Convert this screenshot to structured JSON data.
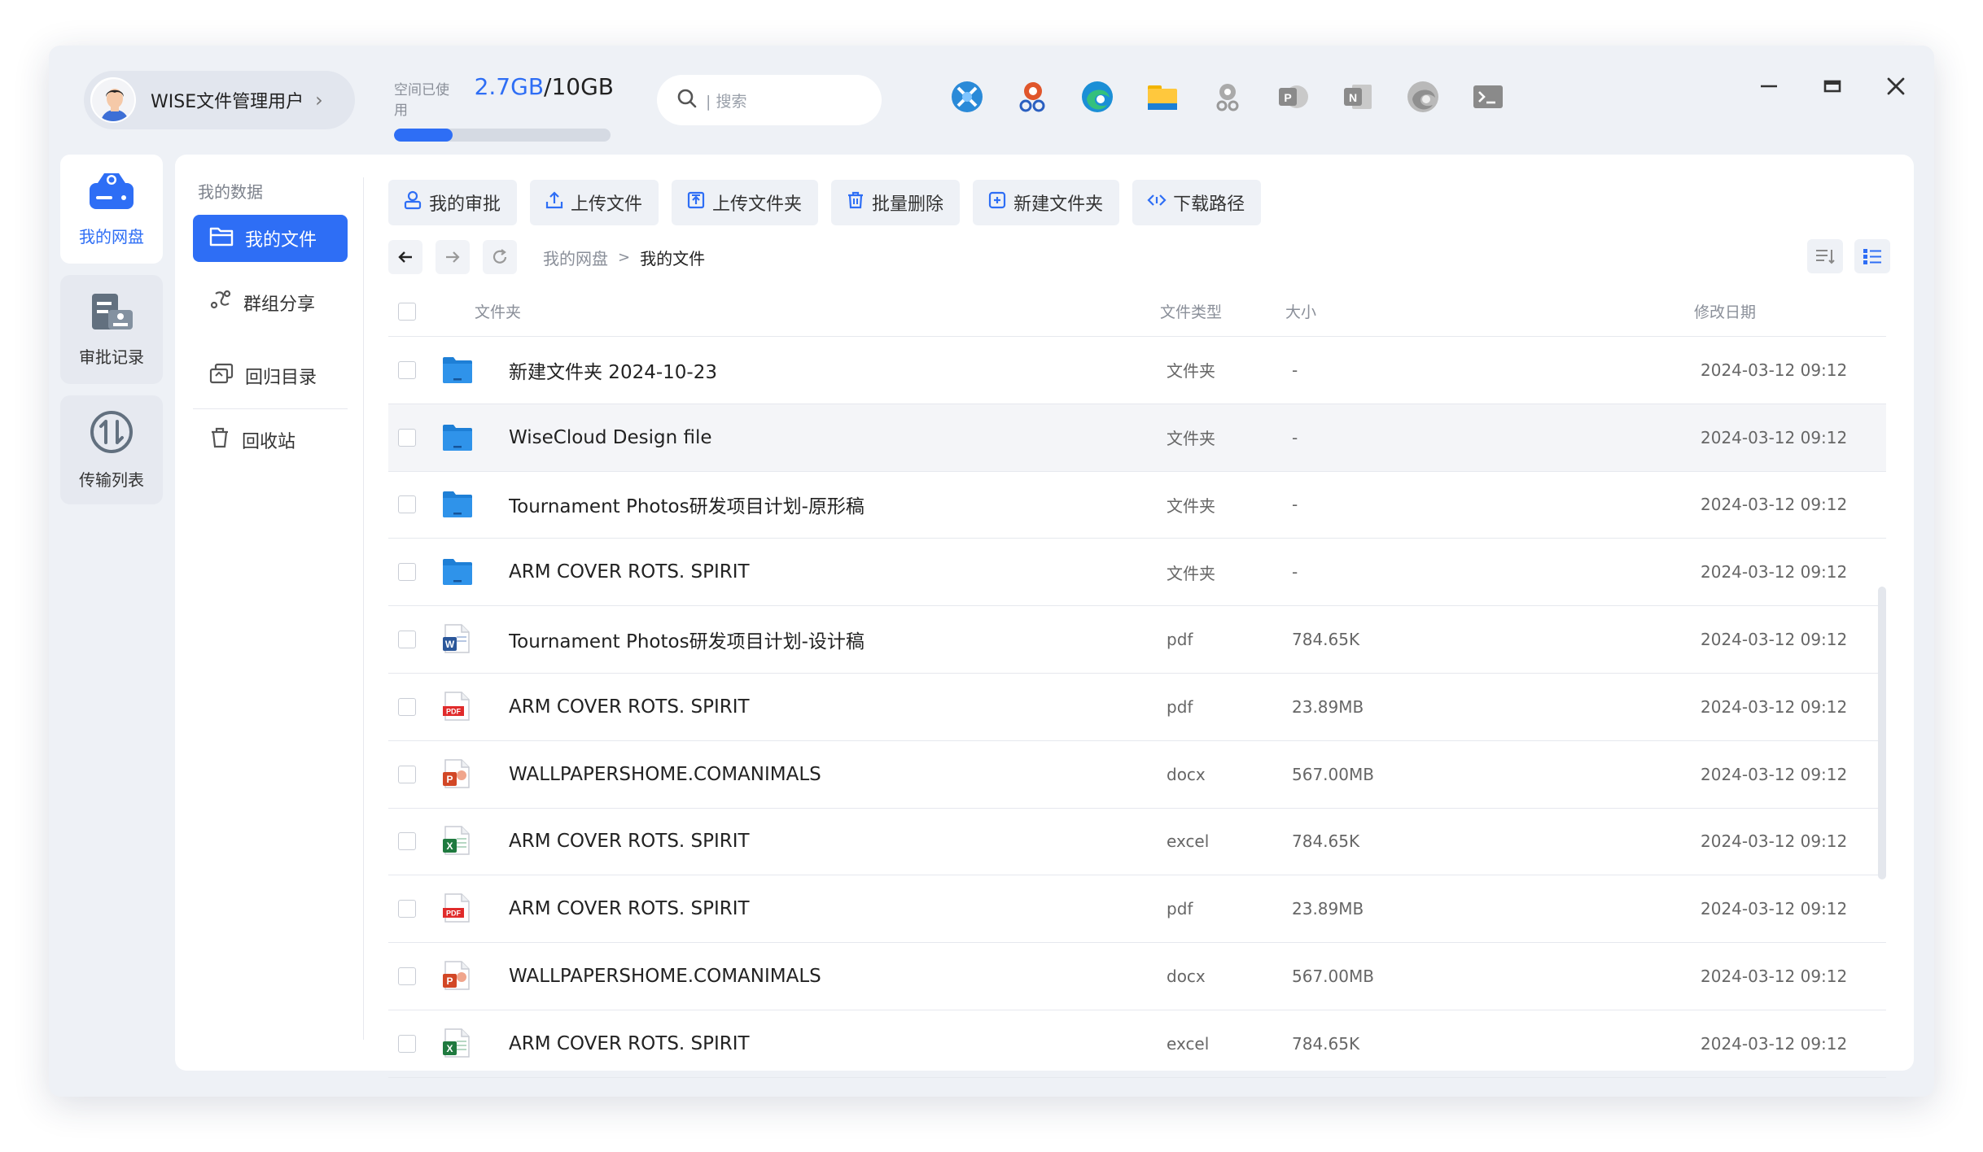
{
  "user": {
    "name": "WISE文件管理用户"
  },
  "storage": {
    "label": "空间已使用",
    "used": "2.7GB",
    "total": "/10GB",
    "used_fraction": 0.27
  },
  "search": {
    "placeholder": "| 搜索"
  },
  "taskbar_apps": [
    "network-app-icon",
    "tools-app-icon",
    "edge-icon",
    "file-explorer-icon",
    "settings-app-icon",
    "powerpoint-icon",
    "onenote-icon",
    "edge-dev-icon",
    "terminal-icon"
  ],
  "rail": [
    {
      "label": "我的网盘",
      "icon": "cloud-drive-icon",
      "active": true
    },
    {
      "label": "审批记录",
      "icon": "approval-record-icon",
      "active": false
    },
    {
      "label": "传输列表",
      "icon": "transfer-icon",
      "active": false
    }
  ],
  "sidebar": {
    "title": "我的数据",
    "items": [
      {
        "label": "我的文件",
        "icon": "folder-open-icon"
      },
      {
        "label": "群组分享",
        "icon": "share-icon"
      },
      {
        "label": "回归目录",
        "icon": "restore-icon"
      },
      {
        "label": "回收站",
        "icon": "trash-icon"
      }
    ]
  },
  "toolbar": [
    {
      "label": "我的审批",
      "icon": "approval-icon"
    },
    {
      "label": "上传文件",
      "icon": "upload-icon"
    },
    {
      "label": "上传文件夹",
      "icon": "upload-folder-icon"
    },
    {
      "label": "批量删除",
      "icon": "delete-icon"
    },
    {
      "label": "新建文件夹",
      "icon": "new-folder-icon"
    },
    {
      "label": "下载路径",
      "icon": "download-path-icon"
    }
  ],
  "breadcrumb": {
    "root": "我的网盘",
    "sep": ">",
    "current": "我的文件"
  },
  "table": {
    "headers": {
      "name": "文件夹",
      "type": "文件类型",
      "size": "大小",
      "date": "修改日期"
    },
    "rows": [
      {
        "name": "新建文件夹 2024-10-23",
        "type": "文件夹",
        "size": "-",
        "date": "2024-03-12 09:12",
        "icon": "folder",
        "highlight": false
      },
      {
        "name": "WiseCloud Design file",
        "type": "文件夹",
        "size": "-",
        "date": "2024-03-12 09:12",
        "icon": "folder",
        "highlight": true
      },
      {
        "name": "Tournament Photos研发项目计划-原形稿",
        "type": "文件夹",
        "size": "-",
        "date": "2024-03-12 09:12",
        "icon": "folder",
        "highlight": false
      },
      {
        "name": "ARM COVER ROTS. SPIRIT",
        "type": "文件夹",
        "size": "-",
        "date": "2024-03-12 09:12",
        "icon": "folder",
        "highlight": false
      },
      {
        "name": "Tournament Photos研发项目计划-设计稿",
        "type": "pdf",
        "size": "784.65K",
        "date": "2024-03-12 09:12",
        "icon": "word",
        "highlight": false
      },
      {
        "name": "ARM COVER ROTS. SPIRIT",
        "type": "pdf",
        "size": "23.89MB",
        "date": "2024-03-12 09:12",
        "icon": "pdf",
        "highlight": false
      },
      {
        "name": "WALLPAPERSHOME.COMANIMALS",
        "type": "docx",
        "size": "567.00MB",
        "date": "2024-03-12 09:12",
        "icon": "ppt",
        "highlight": false
      },
      {
        "name": "ARM COVER ROTS. SPIRIT",
        "type": "excel",
        "size": "784.65K",
        "date": "2024-03-12 09:12",
        "icon": "excel",
        "highlight": false
      },
      {
        "name": "ARM COVER ROTS. SPIRIT",
        "type": "pdf",
        "size": "23.89MB",
        "date": "2024-03-12 09:12",
        "icon": "pdf",
        "highlight": false
      },
      {
        "name": "WALLPAPERSHOME.COMANIMALS",
        "type": "docx",
        "size": "567.00MB",
        "date": "2024-03-12 09:12",
        "icon": "ppt",
        "highlight": false
      },
      {
        "name": "ARM COVER ROTS. SPIRIT",
        "type": "excel",
        "size": "784.65K",
        "date": "2024-03-12 09:12",
        "icon": "excel",
        "highlight": false
      }
    ]
  },
  "colors": {
    "accent": "#2e6ef5",
    "folder": "#1e7fd6",
    "pdf": "#e02b2b",
    "excel": "#1f7a3f",
    "ppt": "#d24726",
    "word": "#2b579a"
  }
}
